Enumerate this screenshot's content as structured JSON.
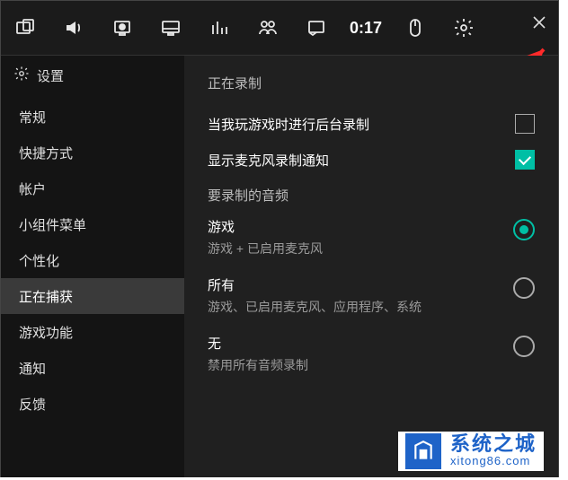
{
  "toolbar": {
    "timer": "0:17",
    "icons": [
      "widgets",
      "audio",
      "capture",
      "display",
      "performance",
      "social",
      "overlay",
      "mouse",
      "settings"
    ]
  },
  "pointer_label": "红",
  "settings": {
    "title": "设置"
  },
  "sidebar": {
    "items": [
      {
        "label": "常规"
      },
      {
        "label": "快捷方式"
      },
      {
        "label": "帐户"
      },
      {
        "label": "小组件菜单"
      },
      {
        "label": "个性化"
      },
      {
        "label": "正在捕获",
        "active": true
      },
      {
        "label": "游戏功能"
      },
      {
        "label": "通知"
      },
      {
        "label": "反馈"
      }
    ]
  },
  "main": {
    "section_title": "正在录制",
    "background_rec_label": "当我玩游戏时进行后台录制",
    "background_rec_checked": false,
    "mic_notif_label": "显示麦克风录制通知",
    "mic_notif_checked": true,
    "audio_group_title": "要录制的音频",
    "options": [
      {
        "title": "游戏",
        "sub": "游戏 + 已启用麦克风",
        "selected": true
      },
      {
        "title": "所有",
        "sub": "游戏、已启用麦克风、应用程序、系统",
        "selected": false
      },
      {
        "title": "无",
        "sub": "禁用所有音频录制",
        "selected": false
      }
    ]
  },
  "watermark": {
    "title": "系统之城",
    "url": "xitong86.com"
  }
}
